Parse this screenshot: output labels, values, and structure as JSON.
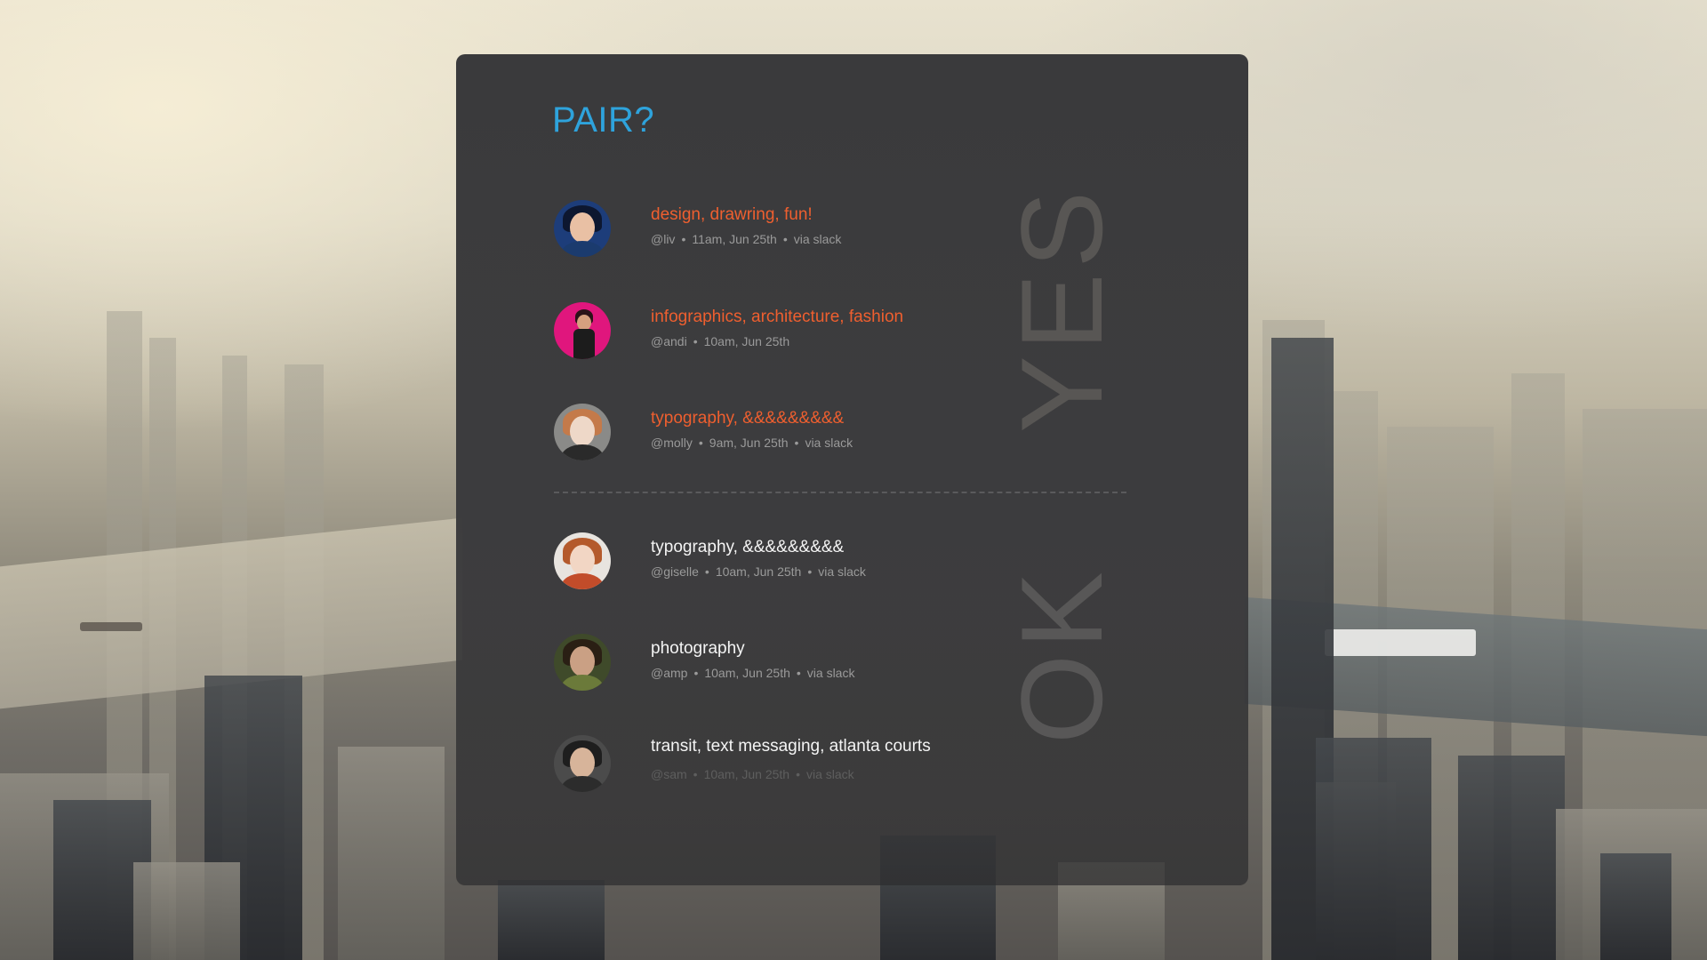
{
  "app": {
    "logo": "PAIR?",
    "accent_color": "#2ea3dc",
    "highlight_color": "#ef5f2f"
  },
  "sections": {
    "yes_label": "YES",
    "ok_label": "OK"
  },
  "yes_items": [
    {
      "topic": "design, drawring, fun!",
      "handle": "@liv",
      "time": "11am, Jun 25th",
      "source": "via slack",
      "avatar": "avatar-liv"
    },
    {
      "topic": "infographics, architecture, fashion",
      "handle": "@andi",
      "time": "10am, Jun 25th",
      "source": "",
      "avatar": "avatar-andi"
    },
    {
      "topic": "typography, &&&&&&&&&",
      "handle": "@molly",
      "time": "9am, Jun 25th",
      "source": "via slack",
      "avatar": "avatar-molly"
    }
  ],
  "ok_items": [
    {
      "topic": "typography, &&&&&&&&&",
      "handle": "@giselle",
      "time": "10am, Jun 25th",
      "source": "via slack",
      "avatar": "avatar-giselle"
    },
    {
      "topic": "photography",
      "handle": "@amp",
      "time": "10am, Jun 25th",
      "source": "via slack",
      "avatar": "avatar-amp"
    },
    {
      "topic": "transit, text messaging, atlanta courts",
      "handle": "@sam",
      "time": "10am, Jun 25th",
      "source": "via slack",
      "avatar": "avatar-sam"
    }
  ],
  "separator": "•"
}
